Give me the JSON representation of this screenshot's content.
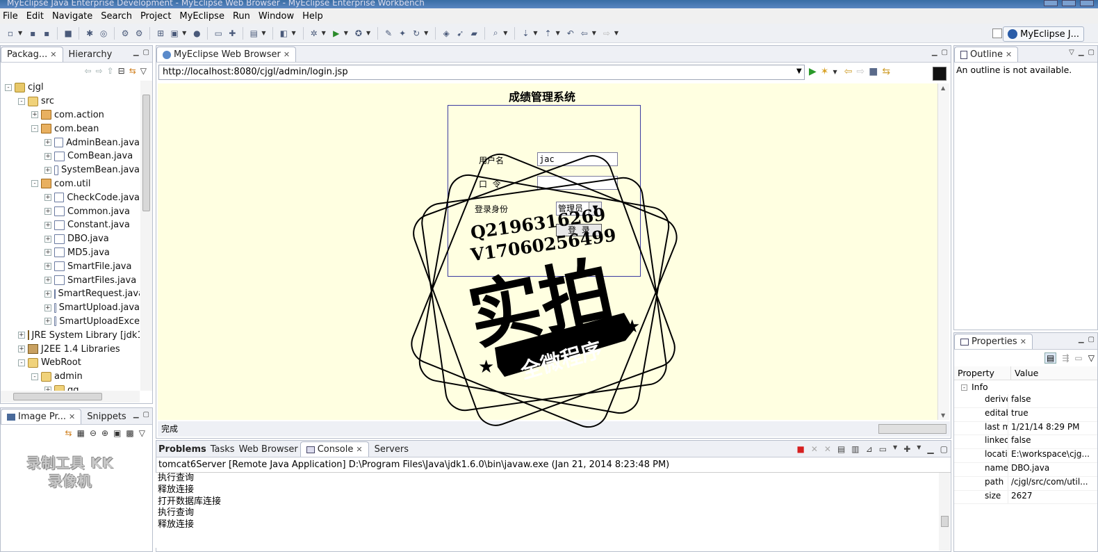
{
  "window": {
    "title": "MyEclipse Java Enterprise Development - MyEclipse Web Browser - MyEclipse Enterprise Workbench"
  },
  "menu": [
    "File",
    "Edit",
    "Navigate",
    "Search",
    "Project",
    "MyEclipse",
    "Run",
    "Window",
    "Help"
  ],
  "perspective": {
    "label": "MyEclipse J..."
  },
  "left_top_view": {
    "tabs": [
      "Packag...",
      "Hierarchy"
    ],
    "tree": [
      {
        "label": "cjgl",
        "level": 0,
        "icon": "project-icon",
        "toggle": "-"
      },
      {
        "label": "src",
        "level": 1,
        "icon": "source-folder-icon",
        "toggle": "-"
      },
      {
        "label": "com.action",
        "level": 2,
        "icon": "package-icon",
        "toggle": "+"
      },
      {
        "label": "com.bean",
        "level": 2,
        "icon": "package-icon",
        "toggle": "-"
      },
      {
        "label": "AdminBean.java",
        "level": 3,
        "icon": "java-file-icon",
        "toggle": "+"
      },
      {
        "label": "ComBean.java",
        "level": 3,
        "icon": "java-file-icon",
        "toggle": "+"
      },
      {
        "label": "SystemBean.java",
        "level": 3,
        "icon": "java-file-icon",
        "toggle": "+"
      },
      {
        "label": "com.util",
        "level": 2,
        "icon": "package-icon",
        "toggle": "-"
      },
      {
        "label": "CheckCode.java",
        "level": 3,
        "icon": "java-file-icon",
        "toggle": "+"
      },
      {
        "label": "Common.java",
        "level": 3,
        "icon": "java-file-icon",
        "toggle": "+"
      },
      {
        "label": "Constant.java",
        "level": 3,
        "icon": "java-file-icon",
        "toggle": "+"
      },
      {
        "label": "DBO.java",
        "level": 3,
        "icon": "java-file-icon",
        "toggle": "+"
      },
      {
        "label": "MD5.java",
        "level": 3,
        "icon": "java-file-icon",
        "toggle": "+"
      },
      {
        "label": "SmartFile.java",
        "level": 3,
        "icon": "java-file-icon",
        "toggle": "+"
      },
      {
        "label": "SmartFiles.java",
        "level": 3,
        "icon": "java-file-icon",
        "toggle": "+"
      },
      {
        "label": "SmartRequest.java",
        "level": 3,
        "icon": "java-file-icon",
        "toggle": "+"
      },
      {
        "label": "SmartUpload.java",
        "level": 3,
        "icon": "java-file-icon",
        "toggle": "+"
      },
      {
        "label": "SmartUploadExce",
        "level": 3,
        "icon": "java-file-icon",
        "toggle": "+"
      },
      {
        "label": "JRE System Library [jdk1",
        "level": 1,
        "icon": "library-icon",
        "toggle": "+"
      },
      {
        "label": "J2EE 1.4 Libraries",
        "level": 1,
        "icon": "library-icon",
        "toggle": "+"
      },
      {
        "label": "WebRoot",
        "level": 1,
        "icon": "folder-icon",
        "toggle": "-"
      },
      {
        "label": "admin",
        "level": 2,
        "icon": "folder-icon",
        "toggle": "-"
      },
      {
        "label": "gg",
        "level": 3,
        "icon": "folder-icon",
        "toggle": "+"
      }
    ]
  },
  "left_bottom_view": {
    "tabs": [
      "Image Pr...",
      "Snippets"
    ],
    "watermark": "录制工具 KK录像机"
  },
  "browser": {
    "tab": "MyEclipse Web Browser",
    "url": "http://localhost:8080/cjgl/admin/login.jsp",
    "status": "完成",
    "page": {
      "title": "成绩管理系统",
      "username_label": "用户名",
      "username_value": "jac",
      "password_label": "口  令",
      "role_label": "登录身份",
      "role_selected": "管理员",
      "submit_label": "登  录"
    }
  },
  "stamp": {
    "line1": "Q2196316269",
    "line2": "V17060256499",
    "main": "实拍",
    "ribbon": "全微程序"
  },
  "bottom_view": {
    "tabs": [
      "Problems",
      "Tasks",
      "Web Browser",
      "Console",
      "Servers"
    ],
    "active_tab": "Console",
    "header": "tomcat6Server [Remote Java Application] D:\\Program Files\\Java\\jdk1.6.0\\bin\\javaw.exe (Jan 21, 2014 8:23:48 PM)",
    "lines": [
      "执行查询",
      "释放连接",
      "打开数据库连接",
      "执行查询",
      "释放连接"
    ]
  },
  "outline_view": {
    "tab": "Outline",
    "message": "An outline is not available."
  },
  "properties_view": {
    "tab": "Properties",
    "headers": [
      "Property",
      "Value"
    ],
    "category": "Info",
    "rows": [
      {
        "k": "derive",
        "v": "false"
      },
      {
        "k": "editab",
        "v": "true"
      },
      {
        "k": "last m",
        "v": "1/21/14 8:29 PM"
      },
      {
        "k": "linked",
        "v": "false"
      },
      {
        "k": "locatic",
        "v": "E:\\workspace\\cjg..."
      },
      {
        "k": "name",
        "v": "DBO.java"
      },
      {
        "k": "path",
        "v": "/cjgl/src/com/util..."
      },
      {
        "k": "size",
        "v": "2627"
      }
    ]
  },
  "colors": {
    "browser_bg": "#ffffe1",
    "accent": "#3a6ea5",
    "stop_red": "#d62020"
  }
}
